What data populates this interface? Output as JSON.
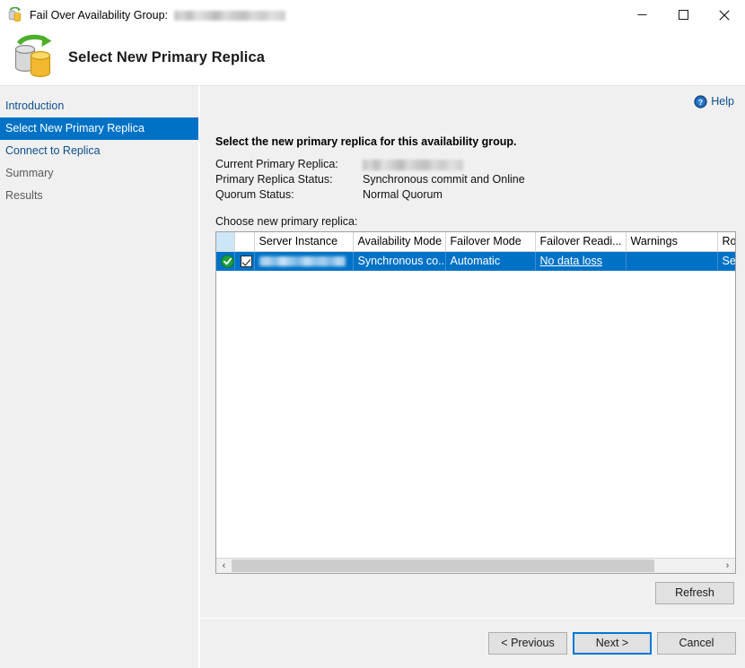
{
  "window": {
    "title_prefix": "Fail Over Availability Group:",
    "title_redacted": true,
    "app_icon": "failover-database-icon",
    "controls": {
      "minimize": "minimize-button",
      "maximize": "maximize-button",
      "close": "close-button"
    }
  },
  "header": {
    "icon": "failover-database-icon",
    "title": "Select New Primary Replica"
  },
  "sidebar": {
    "items": [
      {
        "label": "Introduction",
        "state": "link"
      },
      {
        "label": "Select New Primary Replica",
        "state": "selected"
      },
      {
        "label": "Connect to Replica",
        "state": "link"
      },
      {
        "label": "Summary",
        "state": "disabled"
      },
      {
        "label": "Results",
        "state": "disabled"
      }
    ]
  },
  "help": {
    "icon": "help-icon",
    "label": "Help"
  },
  "main": {
    "instruction": "Select the new primary replica for this availability group.",
    "info": [
      {
        "label": "Current Primary Replica:",
        "value": "",
        "redacted": true
      },
      {
        "label": "Primary Replica Status:",
        "value": "Synchronous commit and Online",
        "redacted": false
      },
      {
        "label": "Quorum Status:",
        "value": "Normal Quorum",
        "redacted": false
      }
    ],
    "choose_label": "Choose new primary replica:",
    "grid": {
      "columns": [
        {
          "key": "status",
          "label": "",
          "width": 20
        },
        {
          "key": "check",
          "label": "",
          "width": 22
        },
        {
          "key": "server_instance",
          "label": "Server Instance",
          "width": 110
        },
        {
          "key": "availability_mode",
          "label": "Availability Mode",
          "width": 103
        },
        {
          "key": "failover_mode",
          "label": "Failover Mode",
          "width": 100
        },
        {
          "key": "failover_readiness",
          "label": "Failover Readi...",
          "width": 101
        },
        {
          "key": "warnings",
          "label": "Warnings",
          "width": 102
        },
        {
          "key": "role",
          "label": "Role",
          "width": 66
        }
      ],
      "rows": [
        {
          "selected": true,
          "status_icon": "status-ok-icon",
          "checked": true,
          "server_instance": "",
          "server_instance_redacted": true,
          "availability_mode": "Synchronous co...",
          "failover_mode": "Automatic",
          "failover_readiness": "No data loss",
          "failover_readiness_is_link": true,
          "warnings": "",
          "role": "Seco"
        }
      ]
    },
    "refresh_label": "Refresh"
  },
  "footer": {
    "previous_label": "< Previous",
    "next_label": "Next >",
    "cancel_label": "Cancel"
  },
  "colors": {
    "accent_blue": "#0072c6",
    "link_blue": "#0d4f8b",
    "sidebar_bg": "#f0f0f0",
    "status_green": "#1c9e3a",
    "header_col_highlight": "#cde6f7"
  }
}
